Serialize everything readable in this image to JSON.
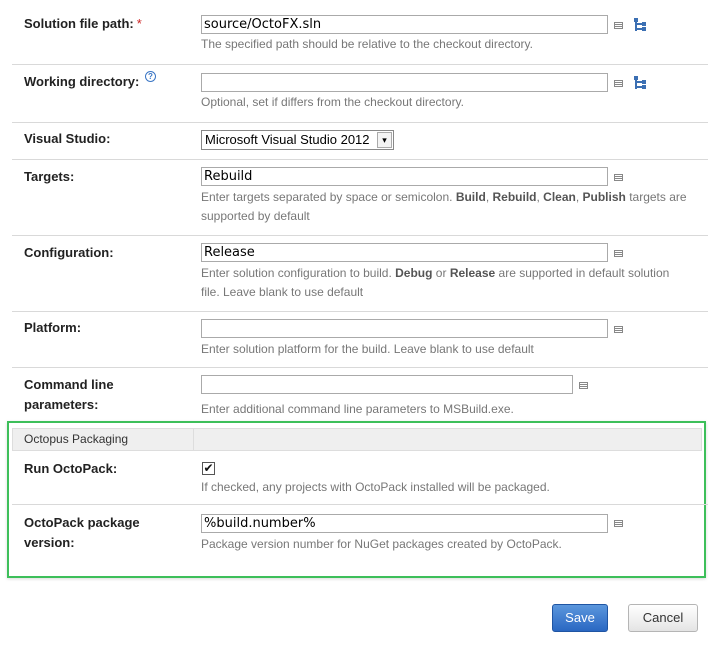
{
  "fields": {
    "solution_path": {
      "label": "Solution file path:",
      "required_marker": "*",
      "value": "source/OctoFX.sln",
      "note": "The specified path should be relative to the checkout directory."
    },
    "working_dir": {
      "label": "Working directory:",
      "help": "?",
      "value": "",
      "note": "Optional, set if differs from the checkout directory."
    },
    "visual_studio": {
      "label": "Visual Studio:",
      "selected": "Microsoft Visual Studio 2012",
      "arrow": "▾"
    },
    "targets": {
      "label": "Targets:",
      "value": "Rebuild",
      "note_1": "Enter targets separated by space or semicolon. ",
      "b1": "Build",
      "sep1": ", ",
      "b2": "Rebuild",
      "sep2": ", ",
      "b3": "Clean",
      "sep3": ", ",
      "b4": "Publish",
      "note_2": " targets are",
      "note_3": "supported by default"
    },
    "configuration": {
      "label": "Configuration:",
      "value": "Release",
      "note_1": "Enter solution configuration to build. ",
      "b1": "Debug",
      "or": " or ",
      "b2": "Release",
      "note_2": " are supported in default solution",
      "note_3": "file. Leave blank to use default"
    },
    "platform": {
      "label": "Platform:",
      "value": "",
      "note": "Enter solution platform for the build. Leave blank to use default"
    },
    "command_line": {
      "label_1": "Command line",
      "label_2": "parameters:",
      "value": "",
      "note": "Enter additional command line parameters to MSBuild.exe."
    }
  },
  "octopus": {
    "section_title": "Octopus Packaging",
    "run_octopack": {
      "label": "Run OctoPack:",
      "checked": true,
      "check_glyph": "✔",
      "note": "If checked, any projects with OctoPack installed will be packaged."
    },
    "package_version": {
      "label_1": "OctoPack package",
      "label_2": "version:",
      "value": "%build.number%",
      "note": "Package version number for NuGet packages created by OctoPack."
    }
  },
  "buttons": {
    "save": "Save",
    "cancel": "Cancel"
  },
  "colors": {
    "section_border": "#3dbf5a",
    "save_button": "#2a67c2",
    "required": "#cc2222"
  },
  "icons": [
    "text-editor-icon",
    "tree-browse-icon",
    "help-icon",
    "checkbox-check-icon",
    "dropdown-arrow-icon"
  ]
}
